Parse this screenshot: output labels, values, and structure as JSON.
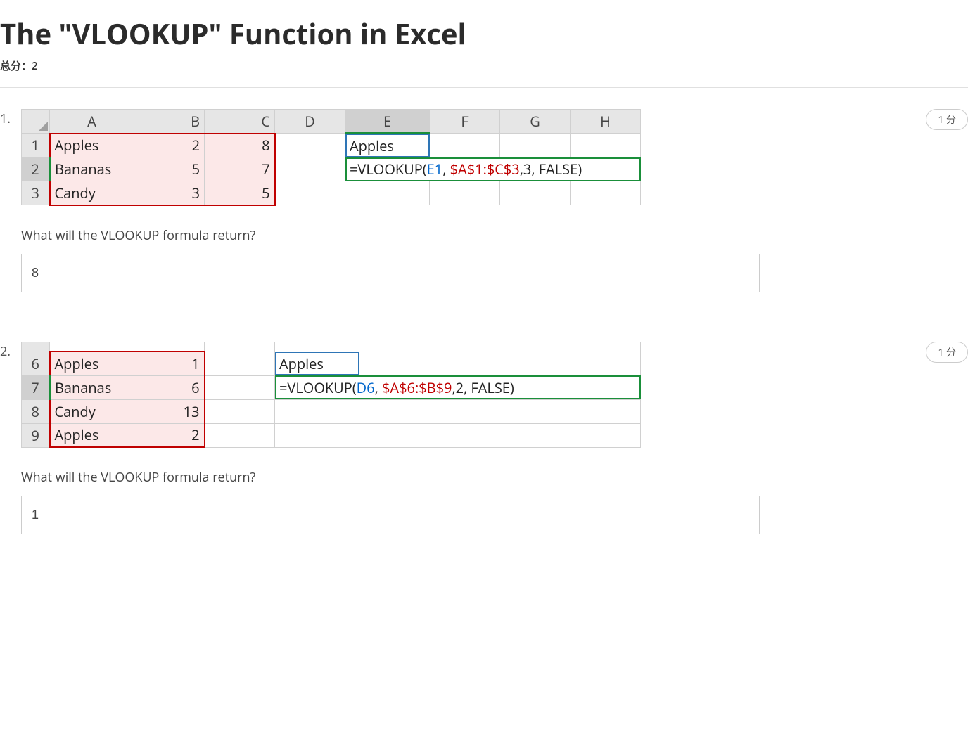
{
  "title": "The \"VLOOKUP\" Function in Excel",
  "total_label": "总分：2",
  "questions": [
    {
      "number": "1.",
      "points": "1 分",
      "columns": [
        "A",
        "B",
        "C",
        "D",
        "E",
        "F",
        "G",
        "H"
      ],
      "rows": [
        {
          "n": "1",
          "A": "Apples",
          "B": "2",
          "C": "8",
          "E": "Apples"
        },
        {
          "n": "2",
          "A": "Bananas",
          "B": "5",
          "C": "7",
          "E_formula": {
            "pre": "=VLOOKUP(",
            "arg1": "E1",
            "sep1": ", ",
            "arg2": "$A$1:$C$3",
            "sep2": ",",
            "arg3": "3",
            "sep3": ", FALSE)"
          }
        },
        {
          "n": "3",
          "A": "Candy",
          "B": "3",
          "C": "5"
        }
      ],
      "prompt": "What will the VLOOKUP formula return?",
      "answer": "8"
    },
    {
      "number": "2.",
      "points": "1 分",
      "rows": [
        {
          "n": "6",
          "A": "Apples",
          "B": "1",
          "D": "Apples"
        },
        {
          "n": "7",
          "A": "Bananas",
          "B": "6",
          "D_formula": {
            "pre": "=VLOOKUP(",
            "arg1": "D6",
            "sep1": ", ",
            "arg2": "$A$6:$B$9",
            "sep2": ",",
            "arg3": "2",
            "sep3": ", FALSE)"
          }
        },
        {
          "n": "8",
          "A": "Candy",
          "B": "13"
        },
        {
          "n": "9",
          "A": "Apples",
          "B": "2"
        }
      ],
      "prompt": "What will the VLOOKUP formula return?",
      "answer": "1"
    }
  ]
}
